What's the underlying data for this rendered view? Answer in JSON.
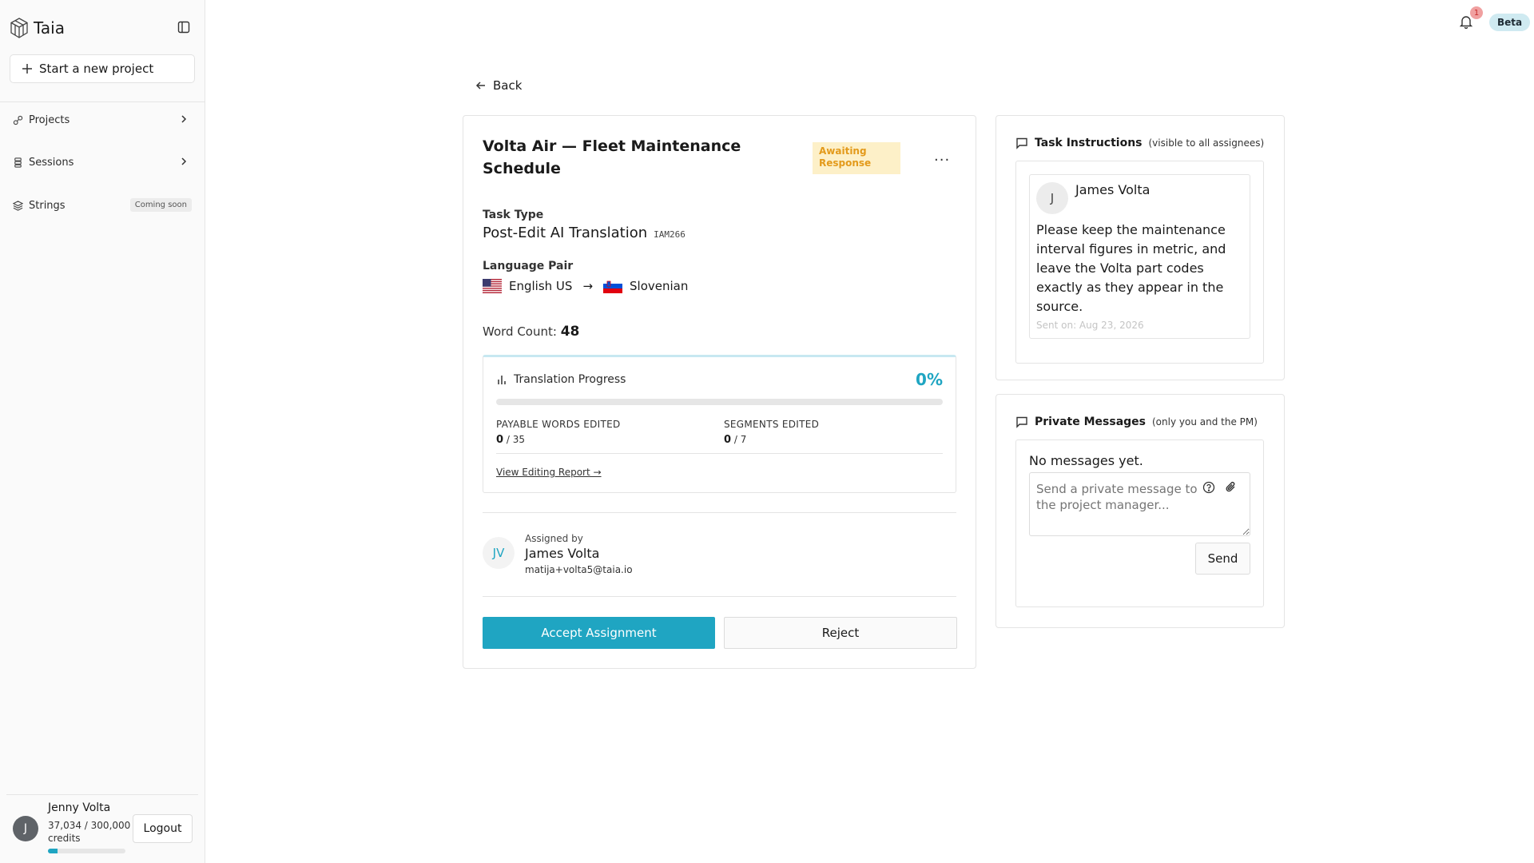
{
  "app": {
    "name": "Taia",
    "new_project_label": "Start a new project",
    "beta_label": "Beta",
    "notification_count": "1"
  },
  "sidebar": {
    "items": [
      {
        "label": "Projects",
        "icon": "projects-icon"
      },
      {
        "label": "Sessions",
        "icon": "sessions-icon"
      },
      {
        "label": "Strings",
        "icon": "layers-icon",
        "badge": "Coming soon"
      }
    ],
    "user": {
      "name": "Jenny Volta",
      "initial": "J",
      "credits_text": "37,034 / 300,000 credits",
      "credits_used_fraction": 0.123,
      "logout_label": "Logout"
    }
  },
  "back_label": "Back",
  "task": {
    "title": "Volta Air — Fleet Maintenance Schedule",
    "status": "Awaiting Response",
    "more_label": "...",
    "task_type_label": "Task Type",
    "task_type": "Post-Edit AI Translation",
    "task_code": "IAM266",
    "language_pair_label": "Language Pair",
    "source_language": "English US",
    "arrow": "→",
    "target_language": "Slovenian",
    "word_count_label": "Word Count:",
    "word_count": "48",
    "progress": {
      "title": "Translation Progress",
      "percent_text": "0%",
      "percent_value": 0,
      "payable_label": "PAYABLE WORDS EDITED",
      "payable_done": "0",
      "payable_total": "/ 35",
      "segments_label": "SEGMENTS EDITED",
      "segments_done": "0",
      "segments_total": "/ 7",
      "report_link": "View Editing Report →"
    },
    "assigned": {
      "label": "Assigned by",
      "initials": "JV",
      "name": "James Volta",
      "email": "matija+volta5@taia.io"
    },
    "accept_label": "Accept Assignment",
    "reject_label": "Reject"
  },
  "instructions": {
    "title": "Task Instructions",
    "subtitle": "(visible to all assignees)",
    "message": {
      "initial": "J",
      "author": "James Volta",
      "text": "Please keep the maintenance interval figures in metric, and leave the Volta part codes exactly as they appear in the source.",
      "sent": "Sent on: Aug 23, 2026"
    }
  },
  "private_messages": {
    "title": "Private Messages",
    "subtitle": "(only you and the PM)",
    "empty_text": "No messages yet.",
    "placeholder": "Send a private message to the project manager...",
    "send_label": "Send"
  },
  "colors": {
    "accent": "#1fa5c2",
    "status_bg": "#fdf0c8",
    "status_text": "#e39a1b"
  }
}
